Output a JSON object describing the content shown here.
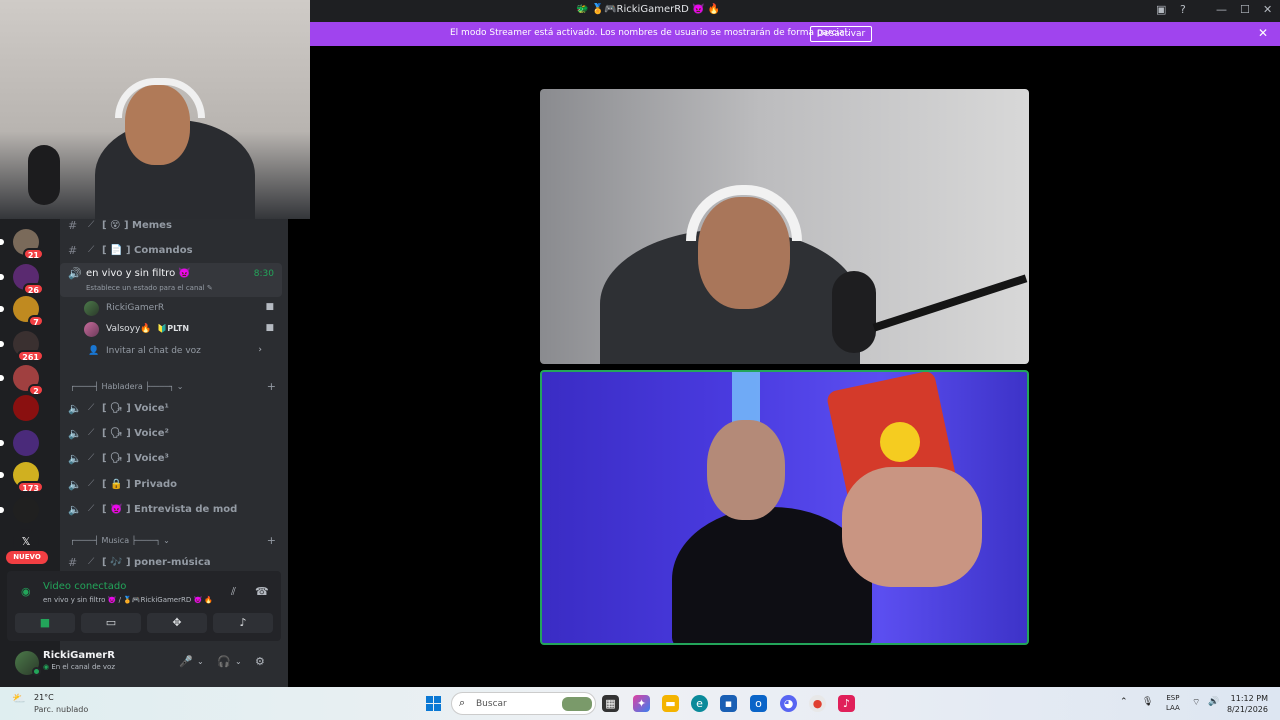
{
  "window": {
    "title": "🐲 🏅🎮RickiGamerRD 👿 🔥"
  },
  "banner": {
    "message": "El modo Streamer está activado. Los nombres de usuario se mostrarán de forma parcial.",
    "button": "Desactivar"
  },
  "servers": {
    "badges": [
      "21",
      "26",
      "7",
      "261",
      "2",
      "173"
    ],
    "new_label": "NUEVO"
  },
  "channels": {
    "memes": "Memes",
    "comandos": "Comandos",
    "active": {
      "name": "en vivo y sin filtro 👿",
      "time": "8:30",
      "status_hint": "Establece un estado para el canal"
    },
    "voice_users": [
      {
        "name": "RickiGamerR"
      },
      {
        "name": "Valsoyy🔥",
        "tag": "🔰PLTN"
      }
    ],
    "invite": "Invitar al chat de voz",
    "cat_habladera": "┌────┤ Habladera ├────┐",
    "voice1": "Voice¹",
    "voice2": "Voice²",
    "voice3": "Voice³",
    "privado": "Privado",
    "entrevista": "Entrevista de mod",
    "cat_musica": "┌────┤ Musica ├────┐",
    "poner_musica": "poner-música"
  },
  "voice_panel": {
    "status": "Video conectado",
    "location": "en vivo y sin filtro 👿 / 🏅🎮RickiGamerRD 👿 🔥"
  },
  "user": {
    "name": "RickiGamerR",
    "status": "En el canal de voz"
  },
  "taskbar": {
    "temp": "21°C",
    "weather": "Parc. nublado",
    "search": "Buscar",
    "lang_top": "ESP",
    "lang_bottom": "LAA",
    "time": "11:12 PM",
    "date": "8/21/2026"
  },
  "colors": {
    "streamer_banner": "#a044ee",
    "connected_green": "#23a55a",
    "badge_red": "#f23f43"
  }
}
